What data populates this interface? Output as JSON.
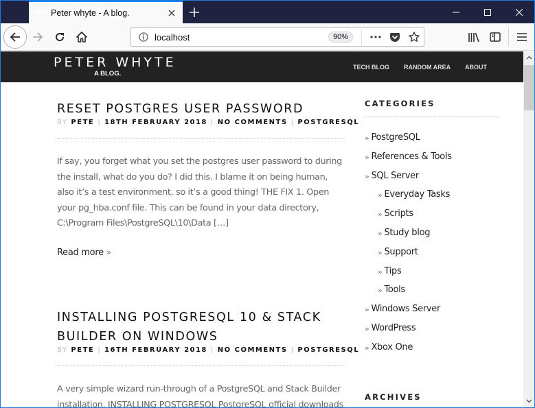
{
  "browser": {
    "tab_title": "Peter whyte - A blog.",
    "favicon_text": "PW",
    "url": "localhost",
    "zoom_level": "90%"
  },
  "site": {
    "title": "PETER WHYTE",
    "tagline": "A BLOG.",
    "nav": [
      "TECH BLOG",
      "RANDOM AREA",
      "ABOUT"
    ]
  },
  "posts": [
    {
      "title": "RESET POSTGRES USER PASSWORD",
      "by_label": "BY",
      "author": "PETE",
      "date": "18TH FEBRUARY 2018",
      "comments": "NO COMMENTS",
      "category": "POSTGRESQL",
      "excerpt": "If say, you forget what you set the postgres user password to during the install, what do you do? I did this. I blame it on being human, also it’s a test environment, so it’s a good thing! THE FIX 1. Open your pg_hba.conf file. This can be found in your data directory, C:\\Program Files\\PostgreSQL\\10\\Data […]",
      "read_more": "Read more"
    },
    {
      "title": "INSTALLING POSTGRESQL 10 & STACK BUILDER ON WINDOWS",
      "by_label": "BY",
      "author": "PETE",
      "date": "16TH FEBRUARY 2018",
      "comments": "NO COMMENTS",
      "category": "POSTGRESQL",
      "excerpt": "A very simple wizard run-through of a PostgreSQL and Stack Builder installation. INSTALLING POSTGRESQL PostgreSQL official downloads"
    }
  ],
  "sidebar": {
    "categories_title": "CATEGORIES",
    "categories": [
      {
        "label": "PostgreSQL",
        "child": false
      },
      {
        "label": "References & Tools",
        "child": false
      },
      {
        "label": "SQL Server",
        "child": false
      },
      {
        "label": "Everyday Tasks",
        "child": true
      },
      {
        "label": "Scripts",
        "child": true
      },
      {
        "label": "Study blog",
        "child": true
      },
      {
        "label": "Support",
        "child": true
      },
      {
        "label": "Tips",
        "child": true
      },
      {
        "label": "Tools",
        "child": true
      },
      {
        "label": "Windows Server",
        "child": false
      },
      {
        "label": "WordPress",
        "child": false
      },
      {
        "label": "Xbox One",
        "child": false
      }
    ],
    "archives_title": "ARCHIVES"
  },
  "raquo": "»",
  "sep": "|"
}
